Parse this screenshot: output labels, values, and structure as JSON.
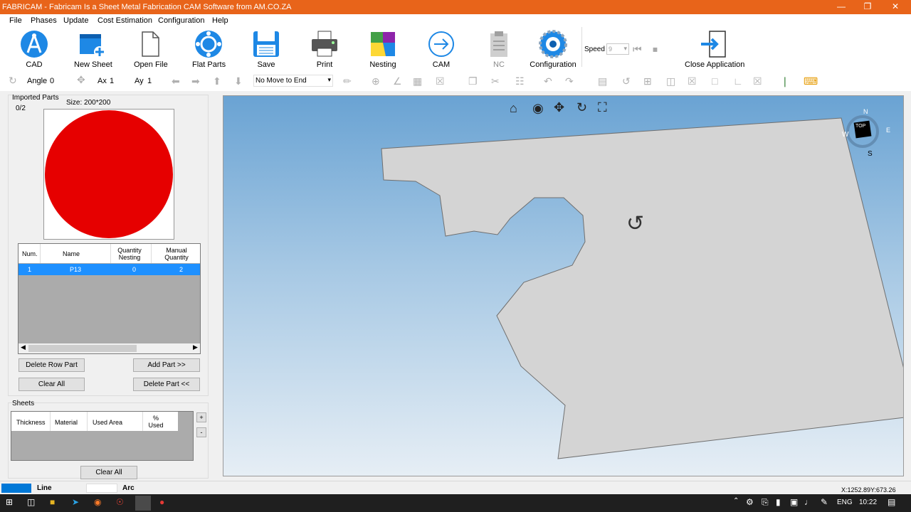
{
  "window": {
    "title": "FABRICAM - Fabricam Is a Sheet Metal Fabrication CAM Software from AM.CO.ZA"
  },
  "menu": [
    "File",
    "Phases",
    "Update",
    "Cost Estimation",
    "Configuration",
    "Help"
  ],
  "ribbon": {
    "cad": "CAD",
    "new_sheet": "New Sheet",
    "open_file": "Open File",
    "flat_parts": "Flat Parts",
    "save": "Save",
    "print": "Print",
    "nesting": "Nesting",
    "cam": "CAM",
    "nc": "NC",
    "configuration": "Configuration",
    "speed_label": "Speed",
    "speed_value": "9",
    "close_application": "Close Application"
  },
  "toolbar": {
    "angle_label": "Angle",
    "angle_value": "0",
    "ax_label": "Ax",
    "ax_value": "1",
    "ay_label": "Ay",
    "ay_value": "1",
    "move_option": "No Move to End"
  },
  "imported_parts": {
    "title": "Imported Parts",
    "count": "0/2",
    "size": "Size: 200*200",
    "preview_color": "#e60000",
    "columns": [
      "Num.",
      "Name",
      "Quantity Nesting",
      "Manual Quantity"
    ],
    "rows": [
      {
        "num": "1",
        "name": "P13",
        "qty_nesting": "0",
        "manual_qty": "2"
      }
    ],
    "buttons": {
      "delete_row": "Delete Row Part",
      "add_part": "Add Part >>",
      "clear_all": "Clear All",
      "delete_part": "Delete Part <<"
    }
  },
  "sheets": {
    "title": "Sheets",
    "columns": [
      "Thickness",
      "Material",
      "Used Area",
      "% Used"
    ],
    "plus": "+",
    "minus": "-",
    "clear_all": "Clear All"
  },
  "viewcube": {
    "top": "TOP",
    "n": "N",
    "s": "S",
    "e": "E",
    "w": "W"
  },
  "status": {
    "line": "Line",
    "arc": "Arc",
    "line_color": "#0078d7",
    "coords": "X:1252.89Y:673.26"
  },
  "taskbar": {
    "lang": "ENG",
    "time": "10:22"
  },
  "colors": {
    "title_bar": "#e8641a",
    "selection": "#1e90ff",
    "part_fill": "#d4d4d4"
  }
}
